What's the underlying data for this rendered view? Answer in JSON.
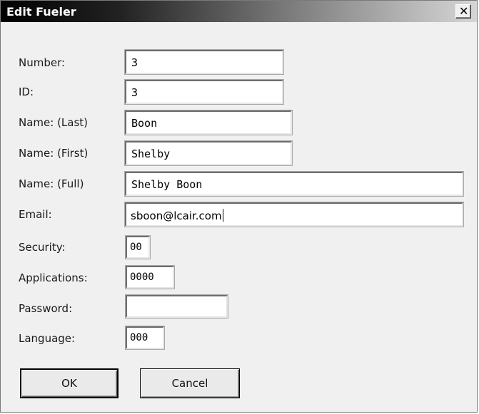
{
  "window": {
    "title": "Edit Fueler",
    "close_glyph": "✕",
    "close_icon": "close-icon"
  },
  "form": {
    "number_label": "Number:",
    "number_value": "3",
    "id_label": "ID:",
    "id_value": "3",
    "last_label": "Name: (Last)",
    "last_value": "Boon",
    "first_label": "Name: (First)",
    "first_value": "Shelby",
    "full_label": "Name: (Full)",
    "full_value": "Shelby Boon",
    "email_label": "Email:",
    "email_value": "sboon@lcair.com",
    "security_label": "Security:",
    "security_value": "00",
    "applications_label": "Applications:",
    "applications_value": "0000",
    "password_label": "Password:",
    "password_value": "",
    "language_label": "Language:",
    "language_value": "000"
  },
  "buttons": {
    "ok": "OK",
    "cancel": "Cancel"
  }
}
